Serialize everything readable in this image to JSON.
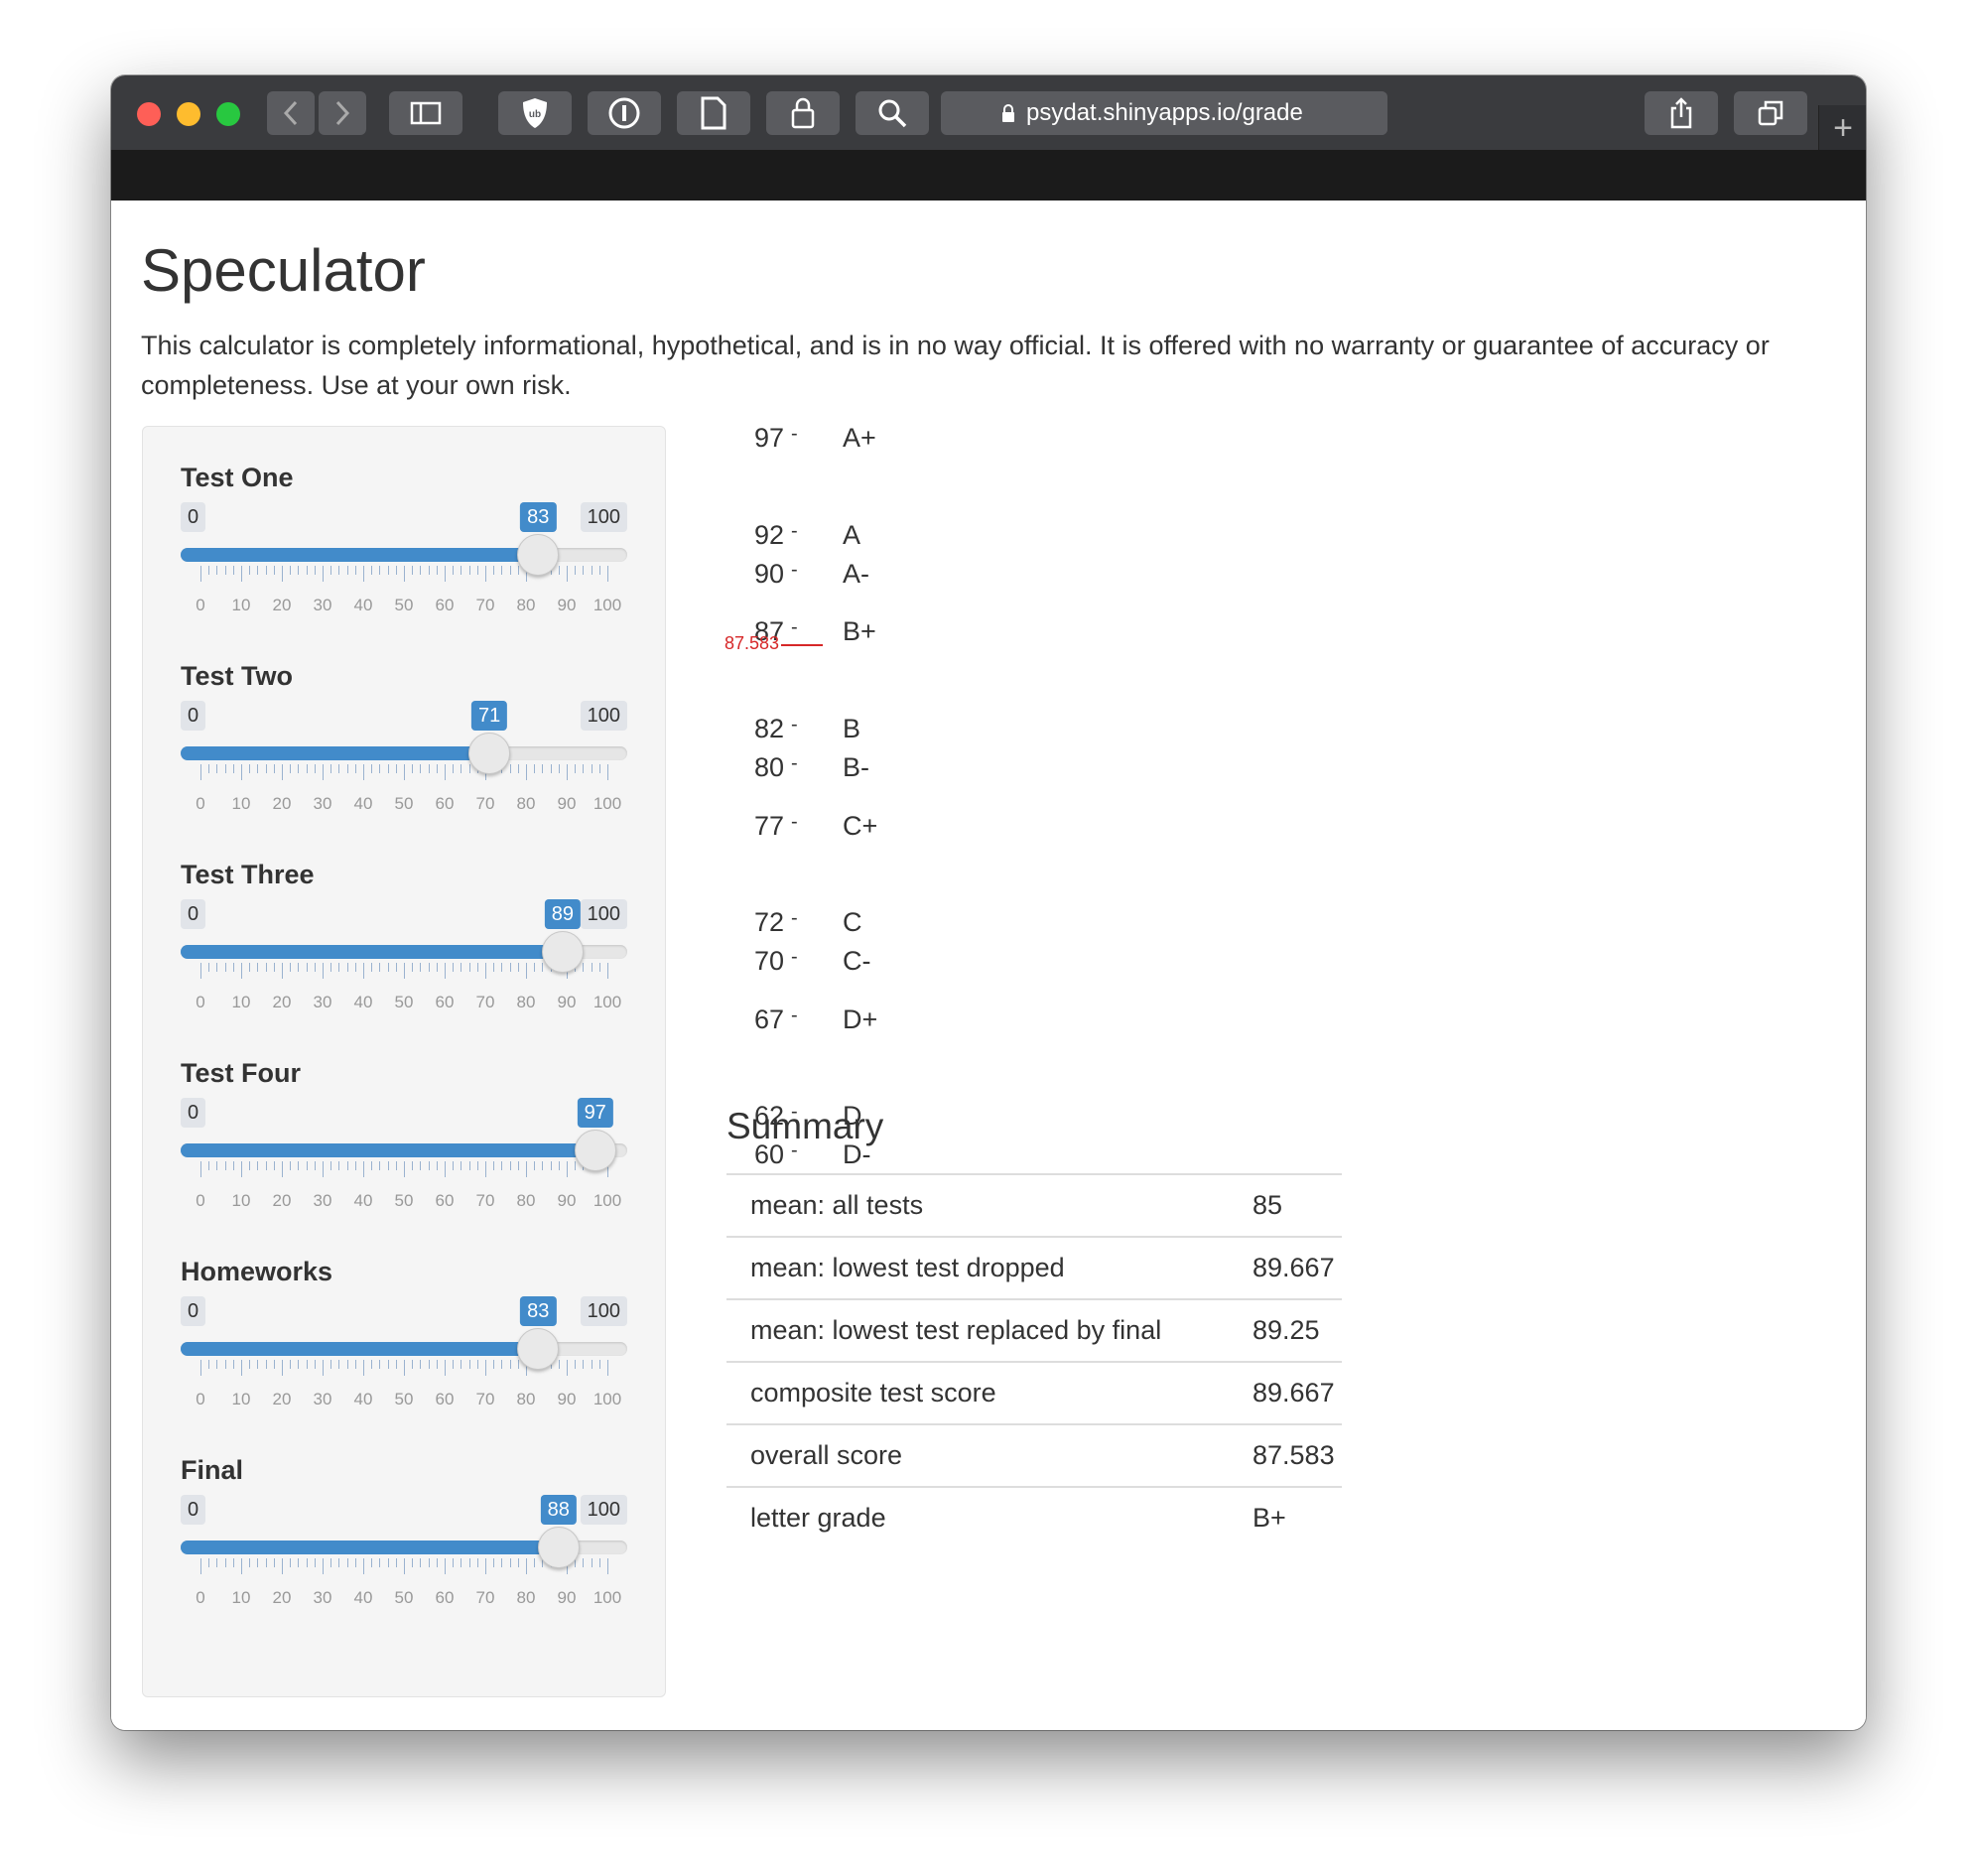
{
  "browser": {
    "url": "psydat.shinyapps.io/grade",
    "new_tab": "+"
  },
  "page": {
    "title": "Speculator",
    "disclaimer": "This calculator is completely informational, hypothetical, and is in no way official. It is offered with no warranty or guarantee of accuracy or completeness. Use at your own risk."
  },
  "sliders": [
    {
      "label": "Test One",
      "min": "0",
      "max": "100",
      "value": "83"
    },
    {
      "label": "Test Two",
      "min": "0",
      "max": "100",
      "value": "71"
    },
    {
      "label": "Test Three",
      "min": "0",
      "max": "100",
      "value": "89"
    },
    {
      "label": "Test Four",
      "min": "0",
      "max": "100",
      "value": "97"
    },
    {
      "label": "Homeworks",
      "min": "0",
      "max": "100",
      "value": "83"
    },
    {
      "label": "Final",
      "min": "0",
      "max": "100",
      "value": "88"
    }
  ],
  "slider_tick_labels": [
    "0",
    "10",
    "20",
    "30",
    "40",
    "50",
    "60",
    "70",
    "80",
    "90",
    "100"
  ],
  "grade_scale": [
    {
      "cutoff": "97",
      "letter": "A+"
    },
    {
      "cutoff": "92",
      "letter": "A"
    },
    {
      "cutoff": "90",
      "letter": "A-"
    },
    {
      "cutoff": "87",
      "letter": "B+"
    },
    {
      "cutoff": "82",
      "letter": "B"
    },
    {
      "cutoff": "80",
      "letter": "B-"
    },
    {
      "cutoff": "77",
      "letter": "C+"
    },
    {
      "cutoff": "72",
      "letter": "C"
    },
    {
      "cutoff": "70",
      "letter": "C-"
    },
    {
      "cutoff": "67",
      "letter": "D+"
    },
    {
      "cutoff": "62",
      "letter": "D"
    },
    {
      "cutoff": "60",
      "letter": "D-"
    }
  ],
  "score_marker": "87.583",
  "summary": {
    "title": "Summary",
    "rows": [
      {
        "label": "mean: all tests",
        "value": "85"
      },
      {
        "label": "mean: lowest test dropped",
        "value": "89.667"
      },
      {
        "label": "mean: lowest test replaced by final",
        "value": "89.25"
      },
      {
        "label": "composite test score",
        "value": "89.667"
      },
      {
        "label": "overall score",
        "value": "87.583"
      },
      {
        "label": "letter grade",
        "value": "B+"
      }
    ]
  },
  "colors": {
    "accent": "#428bca",
    "marker": "#d62728",
    "titlebar": "#3a3b3e"
  }
}
